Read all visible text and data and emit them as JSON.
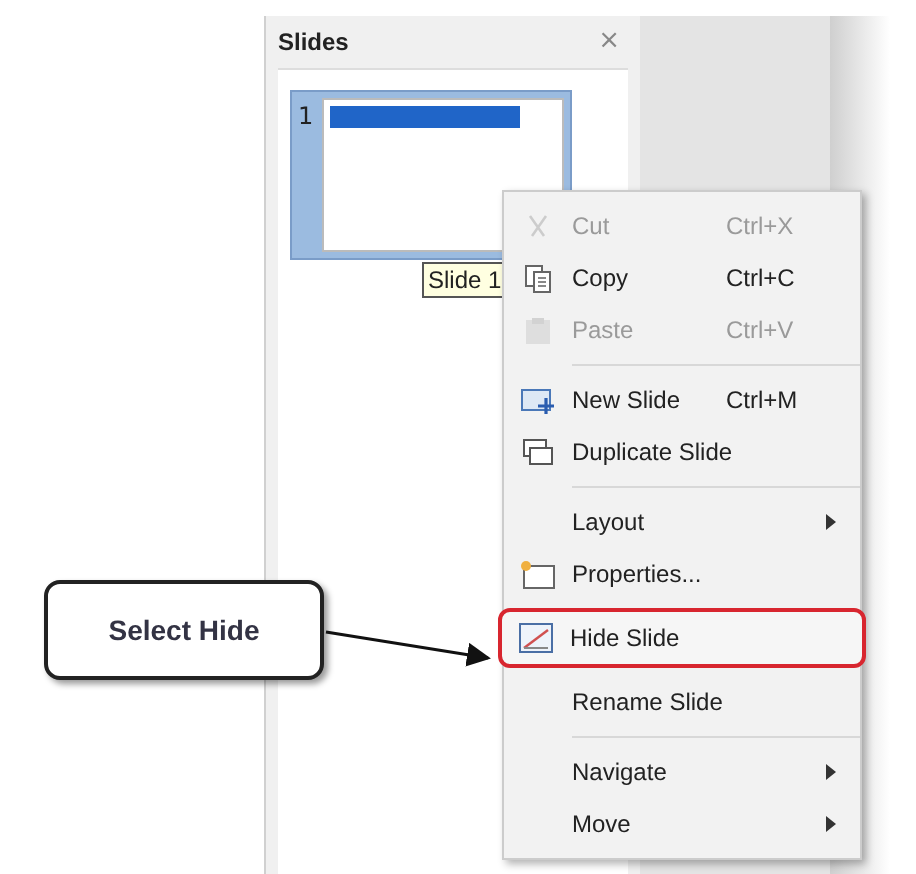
{
  "panel": {
    "title": "Slides",
    "close": "×"
  },
  "slides": [
    {
      "number": "1",
      "selected": true
    }
  ],
  "tooltip": "Slide 1",
  "menu": [
    {
      "kind": "item",
      "label": "Cut",
      "shortcut": "Ctrl+X",
      "disabled": true,
      "submenu": false
    },
    {
      "kind": "item",
      "label": "Copy",
      "shortcut": "Ctrl+C",
      "disabled": false,
      "submenu": false
    },
    {
      "kind": "item",
      "label": "Paste",
      "shortcut": "Ctrl+V",
      "disabled": true,
      "submenu": false
    },
    {
      "kind": "separator"
    },
    {
      "kind": "item",
      "label": "New Slide",
      "shortcut": "Ctrl+M",
      "disabled": false,
      "submenu": false
    },
    {
      "kind": "item",
      "label": "Duplicate Slide",
      "disabled": false,
      "submenu": false
    },
    {
      "kind": "separator"
    },
    {
      "kind": "item",
      "label": "Layout",
      "disabled": false,
      "submenu": true
    },
    {
      "kind": "item",
      "label": "Properties...",
      "disabled": false,
      "submenu": false
    },
    {
      "kind": "item",
      "label": "Hide Slide",
      "disabled": false,
      "submenu": false,
      "highlighted": true
    },
    {
      "kind": "item",
      "label": "Rename Slide",
      "disabled": false,
      "submenu": false
    },
    {
      "kind": "separator"
    },
    {
      "kind": "item",
      "label": "Navigate",
      "disabled": false,
      "submenu": true
    },
    {
      "kind": "item",
      "label": "Move",
      "disabled": false,
      "submenu": true
    }
  ],
  "callout": {
    "text": "Select Hide"
  }
}
